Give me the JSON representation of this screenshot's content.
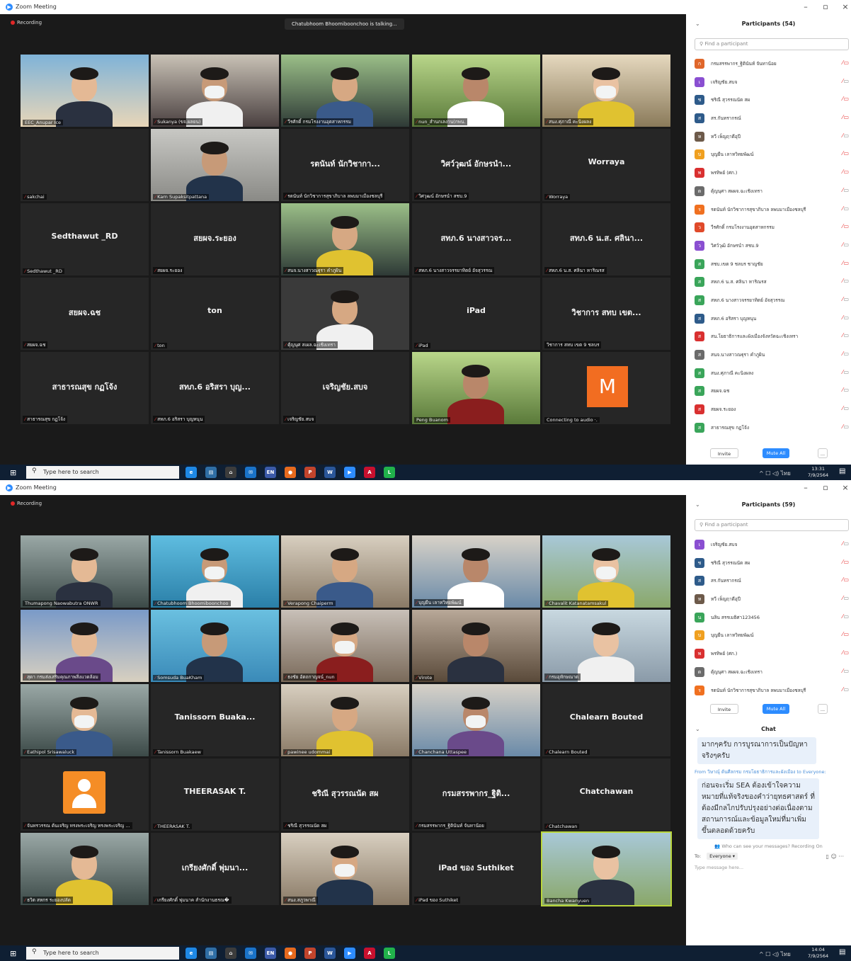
{
  "window": {
    "title": "Zoom Meeting",
    "app_icon": "zoom-icon"
  },
  "recording_label": "Recording",
  "screen1": {
    "talking_banner": "Chatubhoom Bhoomiboonchoo is talking...",
    "participants_title": "Participants (54)",
    "search_placeholder": "Find a participant",
    "tiles": [
      {
        "video": true,
        "label": "EEC_Anupar Ice",
        "muted": false
      },
      {
        "video": true,
        "label": "Sukanya (ขจ.ผลยน)",
        "muted": true
      },
      {
        "video": true,
        "label": "วีรศักดิ์ กรมโรงงานอุตสาหกรรม",
        "muted": true
      },
      {
        "video": true,
        "label": "nun_สำนกเลงาน(กพน.",
        "muted": true
      },
      {
        "video": true,
        "label": "สนง.ศุภาณี คะนิงผลง",
        "muted": true
      },
      {
        "video": false,
        "label": "sakchai",
        "muted": true,
        "bigname": ""
      },
      {
        "video": true,
        "label": "Karn Supaksitpattana",
        "muted": true
      },
      {
        "video": false,
        "label": "รตนันท์ นักวิชาการสุขาภิบาล ลพบมาเมืองชลบุรี",
        "muted": true,
        "bigname": "รตนันท์ นักวิชากา..."
      },
      {
        "video": false,
        "label": "วิศวุฒน์ อักษรนำ สชบ.9",
        "muted": true,
        "bigname": "วิศว์วุฒน์ อักษรนำ..."
      },
      {
        "video": false,
        "label": "Worraya",
        "muted": true,
        "bigname": "Worraya"
      },
      {
        "video": false,
        "label": "Sedthawut _RD",
        "muted": true,
        "bigname": "Sedthawut _RD"
      },
      {
        "video": false,
        "label": "สยผจ.ระยอง",
        "muted": true,
        "bigname": "สยผจ.ระยอง"
      },
      {
        "video": true,
        "label": "สนจ.นางสาวณฐุรา คำภูผิน",
        "muted": true
      },
      {
        "video": false,
        "label": "สทภ.6 นางสาวจรรยาทิตย์ อัจสุวรรณ",
        "muted": true,
        "bigname": "สทภ.6 นางสาวจร..."
      },
      {
        "video": false,
        "label": "สทภ.6 น.ส. ศลินา หาริณรส",
        "muted": true,
        "bigname": "สทภ.6 น.ส. ศลินา..."
      },
      {
        "video": false,
        "label": "สยผจ.ฉช",
        "muted": true,
        "bigname": "สยผจ.ฉช"
      },
      {
        "video": false,
        "label": "ton",
        "muted": true,
        "bigname": "ton"
      },
      {
        "video": true,
        "label": "ตุ้ญนุศ สเผล.ฉะเชิงเทรา",
        "muted": true
      },
      {
        "video": false,
        "label": "iPad",
        "muted": true,
        "bigname": "iPad"
      },
      {
        "video": false,
        "label": "วิชาการ สทบ เขต 9 ชลบร",
        "muted": false,
        "bigname": "วิชาการ สทบ เขต..."
      },
      {
        "video": false,
        "label": "สาธารณสุข กฏโจ้ง",
        "muted": true,
        "bigname": "สาธารณสุข กฏโจ้ง"
      },
      {
        "video": false,
        "label": "สทภ.6 อริสรา บุญหนุน",
        "muted": true,
        "bigname": "สทภ.6 อริสรา บุญ..."
      },
      {
        "video": false,
        "label": "เจริญชัย.สบจ",
        "muted": true,
        "bigname": "เจริญชัย.สบจ"
      },
      {
        "video": true,
        "label": "Peng Buanom",
        "muted": false
      },
      {
        "video": false,
        "label": "Connecting to audio ·.",
        "muted": false,
        "badge": "M"
      }
    ],
    "participants": [
      {
        "initial": "ก",
        "name": "กรมสรรพากร_ฐิตินันท์ จันทาน้อย",
        "color": "#e0662a",
        "video_off": true,
        "mic_muted": true
      },
      {
        "initial": "เ",
        "name": "เจริญชัย.สบจ",
        "color": "#8a4fd1",
        "video_off": false,
        "mic_muted": true
      },
      {
        "initial": "ช",
        "name": "ชริณี สุวรรณนัด สผ",
        "color": "#2e5b8a",
        "video_off": true,
        "mic_muted": true
      },
      {
        "initial": "ส",
        "name": "สร.กันทรากรณ์",
        "color": "#2e5b8a",
        "video_off": true,
        "mic_muted": true
      },
      {
        "initial": "ห",
        "name": "หวี เพ็ญฤาดีอุปี",
        "color": "#6d5a4a",
        "video_off": false,
        "mic_muted": true
      },
      {
        "initial": "บ",
        "name": "บุญยืน เลาหวิทยพัฒน์",
        "color": "#f0a020",
        "video_off": true,
        "mic_muted": true
      },
      {
        "initial": "พ",
        "name": "พรทิพย์ (ศก.)",
        "color": "#d93030",
        "video_off": true,
        "mic_muted": true
      },
      {
        "initial": "ต",
        "name": "ตุ้ญนุศา สผผจ.ฉะเชิงเทรา",
        "color": "#6b6b6b",
        "video_off": false,
        "mic_muted": true
      },
      {
        "initial": "ร",
        "name": "รตนันท์ นักวิชาการสุขาภิบาล ลพบมาเมืองชลบุรี",
        "color": "#f07020",
        "video_off": false,
        "mic_muted": true
      },
      {
        "initial": "ว",
        "name": "วีรศักดิ์ กรมโรงงานอุตสาหกรรม",
        "color": "#e04a2a",
        "video_off": true,
        "mic_muted": true
      },
      {
        "initial": "ว",
        "name": "วิศว์วุฒิ อักษรนำ สชบ.9",
        "color": "#8a4fd1",
        "video_off": false,
        "mic_muted": true
      },
      {
        "initial": "ส",
        "name": "สชบ.เขต 9 ชลบร ชาญชัย",
        "color": "#3aa55a",
        "video_off": true,
        "mic_muted": true
      },
      {
        "initial": "ส",
        "name": "สทภ.6 น.ส. ศลินา หาริณรส",
        "color": "#3aa55a",
        "video_off": false,
        "mic_muted": true
      },
      {
        "initial": "ส",
        "name": "สทภ.6 นางสาวจรรยาทิตย์ อัจสุวรรณ",
        "color": "#3aa55a",
        "video_off": false,
        "mic_muted": true
      },
      {
        "initial": "ส",
        "name": "สทภ.6 อริสรา บุญหนุน",
        "color": "#2e5b8a",
        "video_off": false,
        "mic_muted": true
      },
      {
        "initial": "ส",
        "name": "สน.โยธาธิการและผังเมืองจังหวัดฉะเชิงเทรา",
        "color": "#d93030",
        "video_off": false,
        "mic_muted": true
      },
      {
        "initial": "ส",
        "name": "สนจ.นางสาวณฐุรา คำภูผิน",
        "color": "#6b6b6b",
        "video_off": false,
        "mic_muted": true
      },
      {
        "initial": "ส",
        "name": "สนง.ศุภาณี คะนิงผลง",
        "color": "#3aa55a",
        "video_off": false,
        "mic_muted": true
      },
      {
        "initial": "ส",
        "name": "สยผจ.ฉช",
        "color": "#3aa55a",
        "video_off": false,
        "mic_muted": true
      },
      {
        "initial": "ส",
        "name": "สยผจ.ระยอง",
        "color": "#d93030",
        "video_off": false,
        "mic_muted": true
      },
      {
        "initial": "ส",
        "name": "สาธารณสุข กฏโจ้ง",
        "color": "#3aa55a",
        "video_off": false,
        "mic_muted": true
      }
    ],
    "time": "13:31",
    "date": "7/9/2564"
  },
  "screen2": {
    "participants_title": "Participants (59)",
    "search_placeholder": "Find a participant",
    "tiles": [
      {
        "video": true,
        "label": "Thumapong Naowabutra ONWR",
        "muted": false
      },
      {
        "video": true,
        "label": "Chatubhoom Bhoomiboonchoo",
        "muted": true
      },
      {
        "video": true,
        "label": "Verapong Chaiperm",
        "muted": true
      },
      {
        "video": true,
        "label": "บุญยืน เลาหวิทยพัฒน์",
        "muted": true
      },
      {
        "video": true,
        "label": "Chavalit Katanatamsakul",
        "muted": true
      },
      {
        "video": true,
        "label": "สุดา กรมส่งเสริมคุณภาพสิ่งแวดล้อม",
        "muted": true
      },
      {
        "video": true,
        "label": "Somsuda BuaKham",
        "muted": true
      },
      {
        "video": true,
        "label": "ธงชัย อัตถกาญจน์_nun",
        "muted": true
      },
      {
        "video": true,
        "label": "Virote",
        "muted": true
      },
      {
        "video": true,
        "label": "กรมอุทักษณาด",
        "muted": true
      },
      {
        "video": true,
        "label": "Eathipol Srisawaluck",
        "muted": true
      },
      {
        "video": false,
        "label": "Tanissorn Buakaew",
        "muted": true,
        "bigname": "Tanissorn  Buaka..."
      },
      {
        "video": true,
        "label": "pawinee udommai",
        "muted": true
      },
      {
        "video": true,
        "label": "Chanchana Uttaspee",
        "muted": true
      },
      {
        "video": false,
        "label": "Chalearn Bouted",
        "muted": true,
        "bigname": "Chalearn Bouted"
      },
      {
        "video": false,
        "label": "จันทรวรรณ ต้นเจริญ ทรงพระเจริญ ทรงพระเจริญ ...",
        "muted": true,
        "badge": "person"
      },
      {
        "video": false,
        "label": "THEERASAK T.",
        "muted": true,
        "bigname": "THEERASAK T."
      },
      {
        "video": false,
        "label": "ชริณี สุวรรณนัด สผ",
        "muted": true,
        "bigname": "ชริณี สุวรรณนัด สผ"
      },
      {
        "video": false,
        "label": "กรมสรรพากร_ฐิตินันท์ จันทาน้อย",
        "muted": true,
        "bigname": "กรมสรรพากร_ฐิติ..."
      },
      {
        "video": false,
        "label": "Chatchawan",
        "muted": true,
        "bigname": "Chatchawan"
      },
      {
        "video": true,
        "label": "ธวิต สหกร ระยองปลัด",
        "muted": true
      },
      {
        "video": false,
        "label": "เกรียงศักดิ์ พุ่มนาค สำนักงานธรณ�",
        "muted": true,
        "bigname": "เกรียงศักดิ์ พุ่มนา..."
      },
      {
        "video": true,
        "label": "สนง.สภูวพาณี",
        "muted": true
      },
      {
        "video": false,
        "label": "iPad ของ Suthiket",
        "muted": true,
        "bigname": "iPad ของ Suthiket"
      },
      {
        "video": true,
        "label": "Bancha Kwanyuen",
        "muted": false,
        "active": true
      }
    ],
    "participants": [
      {
        "initial": "เ",
        "name": "เจริญชัย.สบจ",
        "color": "#8a4fd1",
        "video_off": false,
        "mic_muted": true
      },
      {
        "initial": "ช",
        "name": "ชริณี สุวรรณนัด สผ",
        "color": "#2e5b8a",
        "video_off": true,
        "mic_muted": true
      },
      {
        "initial": "ส",
        "name": "สร.กันทรากรณ์",
        "color": "#2e5b8a",
        "video_off": true,
        "mic_muted": true
      },
      {
        "initial": "ห",
        "name": "หวี เพ็ญฤาดีอุปี",
        "color": "#6d5a4a",
        "video_off": false,
        "mic_muted": true
      },
      {
        "initial": "น",
        "name": "นลิน สรรเมธิศา123456",
        "color": "#3aa55a",
        "video_off": false,
        "mic_muted": true
      },
      {
        "initial": "บ",
        "name": "บุญยืน เลาหวิทยพัฒน์",
        "color": "#f0a020",
        "video_off": true,
        "mic_muted": true
      },
      {
        "initial": "พ",
        "name": "พรทิพย์ (ศก.)",
        "color": "#d93030",
        "video_off": true,
        "mic_muted": true
      },
      {
        "initial": "ต",
        "name": "ตุ้ญนุศา สผผจ.ฉะเชิงเทรา",
        "color": "#6b6b6b",
        "video_off": false,
        "mic_muted": true
      },
      {
        "initial": "ร",
        "name": "รตนันท์ นักวิชาการสุขาภิบาล ลพบมาเมืองชลบุรี",
        "color": "#f07020",
        "video_off": false,
        "mic_muted": true
      }
    ],
    "chat": {
      "title": "Chat",
      "message1": "มากๆครับ การบูรณาการเป็นปัญหาจริงๆครับ",
      "from_line": "From วิษาณุ์ ต้นศีลกรม กรมโยธาธิการและผังเมือง to Everyone:",
      "message2": "ก่อนจะเริ่ม SEA ต้องเข้าใจความหมายที่แท้จริงของคำว่ายุทธศาสตร์ ที่ต้องมีกลไกปรับปรุงอย่างต่อเนื่องตามสถานการณ์และข้อมูลใหม่ที่มาเพิ่มขึ้นตลอดด้วยครับ",
      "privacy_note": "Who can see your messages? Recording On",
      "to_label": "To:",
      "to_value": "Everyone",
      "input_placeholder": "Type message here..."
    },
    "time": "14:04",
    "date": "7/9/2564"
  },
  "buttons": {
    "invite": "Invite",
    "mute_all": "Mute All",
    "more": "..."
  },
  "taskbar": {
    "search_placeholder": "Type here to search",
    "language": "ไทย"
  },
  "colors": {
    "zoom_blue": "#2d8cff",
    "mute_red": "#e83a3a",
    "active_speaker": "#b9d63c",
    "taskbar": "#0f1f33"
  }
}
